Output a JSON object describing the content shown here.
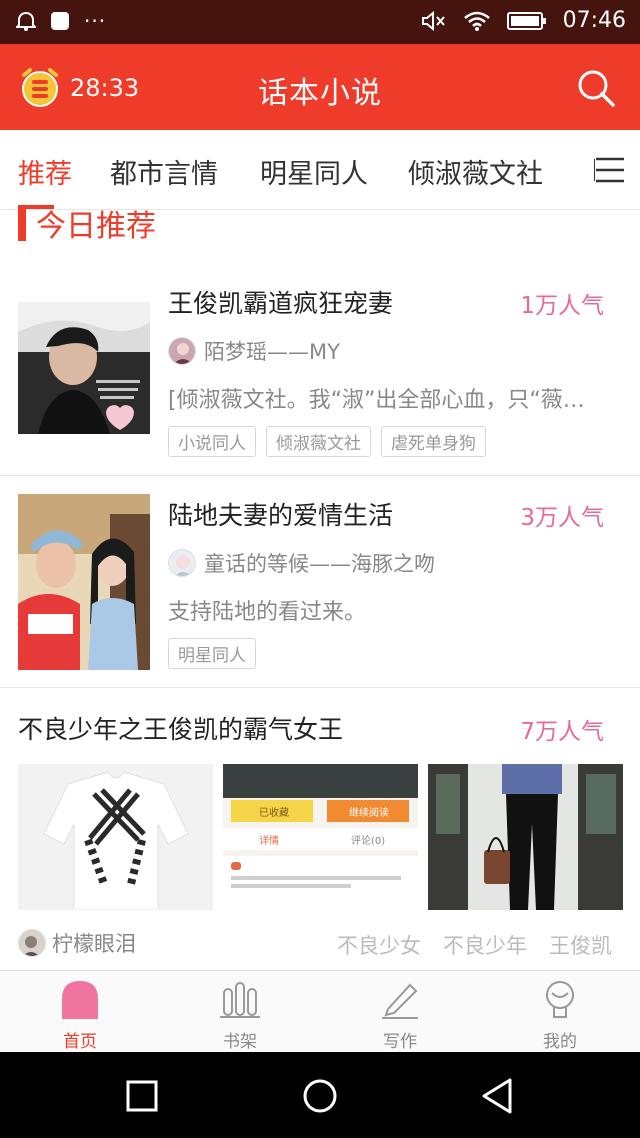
{
  "status_bar": {
    "left_icons": [
      "alarm-icon",
      "notification-square-icon",
      "more-dots-icon"
    ],
    "dots": "···",
    "right_icons": [
      "mute-icon",
      "wifi-icon",
      "battery-icon"
    ],
    "time": "07:46"
  },
  "header": {
    "timer": "28:33",
    "title": "话本小说",
    "search_icon": "search-icon"
  },
  "tabs": [
    {
      "label": "推荐",
      "active": true
    },
    {
      "label": "都市言情",
      "active": false
    },
    {
      "label": "明星同人",
      "active": false
    },
    {
      "label": "倾淑薇文社",
      "active": false
    },
    {
      "label": "[",
      "active": false
    }
  ],
  "section": {
    "title": "今日推荐"
  },
  "books": [
    {
      "title": "王俊凯霸道疯狂宠妻",
      "popularity": "1万人气",
      "author": "陌梦瑶——MY",
      "description": "[倾淑薇文社。我“淑”出全部心血，只“薇…",
      "tags": [
        "小说同人",
        "倾淑薇文社",
        "虐死单身狗"
      ]
    },
    {
      "title": "陆地夫妻的爱情生活",
      "popularity": "3万人气",
      "author": "童话的等候——海豚之吻",
      "description": "支持陆地的看过来。",
      "tags": [
        "明星同人"
      ]
    }
  ],
  "featured": {
    "title": "不良少年之王俊凯的霸气女王",
    "popularity": "7万人气",
    "author": "柠檬眼泪",
    "tags": [
      "不良少女",
      "不良少年",
      "王俊凯"
    ],
    "screenshot_text": {
      "btn_left": "已收藏",
      "btn_right": "继续阅读",
      "row_left": "详情",
      "row_right": "评论(0)"
    }
  },
  "bottom_nav": [
    {
      "label": "首页",
      "icon": "home-icon",
      "active": true
    },
    {
      "label": "书架",
      "icon": "bookshelf-icon",
      "active": false
    },
    {
      "label": "写作",
      "icon": "pencil-icon",
      "active": false
    },
    {
      "label": "我的",
      "icon": "profile-icon",
      "active": false
    }
  ],
  "colors": {
    "primary": "#ef3b2a",
    "status_bar": "#46140f",
    "popularity": "#e8689c"
  }
}
